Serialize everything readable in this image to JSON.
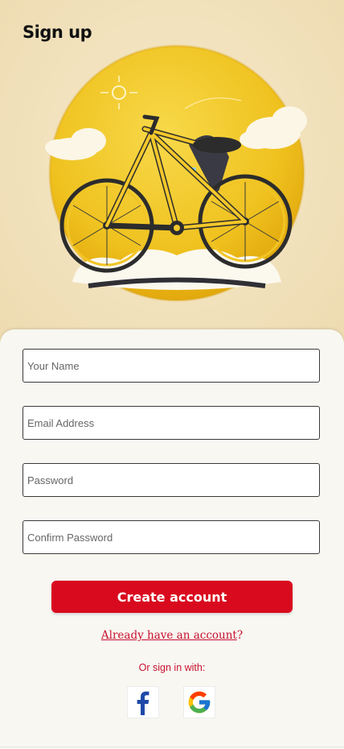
{
  "page": {
    "title": "Sign up"
  },
  "form": {
    "name_placeholder": "Your Name",
    "email_placeholder": "Email Address",
    "password_placeholder": "Password",
    "confirm_placeholder": "Confirm Password"
  },
  "actions": {
    "create_label": "Create account",
    "already_link": "Already have an account",
    "already_suffix": "?",
    "or_text": "Or sign in with:"
  },
  "social": [
    {
      "icon": "facebook-icon"
    },
    {
      "icon": "google-icon"
    }
  ],
  "colors": {
    "brand_red": "#d90a1e",
    "link_red": "#c8102e",
    "hero_bg": "#f2e4c2",
    "card_bg": "#f8f7f2"
  }
}
